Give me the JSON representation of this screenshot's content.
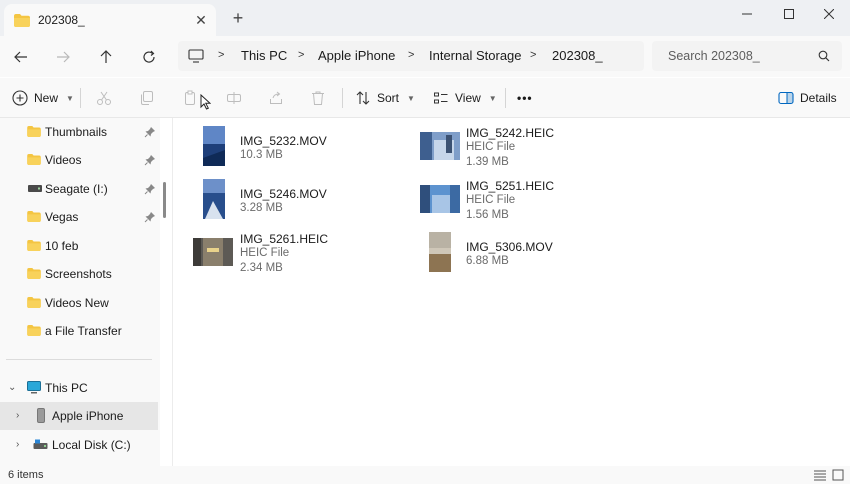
{
  "window": {
    "tab_title": "202308_",
    "new_tab": "+",
    "minimize_icon": "minimize-icon",
    "maximize_icon": "maximize-icon",
    "close_icon": "close-icon"
  },
  "address": {
    "crumbs": [
      "This PC",
      "Apple iPhone",
      "Internal Storage",
      "202308_"
    ],
    "search_placeholder": "Search 202308_"
  },
  "commands": {
    "new_label": "New",
    "sort_label": "Sort",
    "view_label": "View",
    "more_label": "•••",
    "details_label": "Details"
  },
  "sidebar": {
    "quick_access": [
      {
        "label": "Thumbnails",
        "icon": "folder-icon",
        "pinned": true
      },
      {
        "label": "Videos",
        "icon": "folder-icon",
        "pinned": true
      },
      {
        "label": "Seagate (I:)",
        "icon": "drive-icon",
        "pinned": true
      },
      {
        "label": "Vegas",
        "icon": "folder-icon",
        "pinned": true
      },
      {
        "label": "10 feb",
        "icon": "folder-icon",
        "pinned": false
      },
      {
        "label": "Screenshots",
        "icon": "folder-icon",
        "pinned": false
      },
      {
        "label": "Videos New",
        "icon": "folder-icon",
        "pinned": false
      },
      {
        "label": "a File Transfer",
        "icon": "folder-icon",
        "pinned": false
      }
    ],
    "tree": [
      {
        "label": "This PC",
        "icon": "pc-icon",
        "expanded": true
      },
      {
        "label": "Apple iPhone",
        "icon": "phone-icon",
        "selected": true
      },
      {
        "label": "Local Disk (C:)",
        "icon": "disk-icon"
      }
    ]
  },
  "files": [
    {
      "name": "IMG_5232.MOV",
      "type": "",
      "size": "10.3 MB",
      "thumb_color": "#3c63a8"
    },
    {
      "name": "IMG_5242.HEIC",
      "type": "HEIC File",
      "size": "1.39 MB",
      "thumb_color": "#5a7fb5"
    },
    {
      "name": "IMG_5246.MOV",
      "type": "",
      "size": "3.28 MB",
      "thumb_color": "#2f5a94"
    },
    {
      "name": "IMG_5251.HEIC",
      "type": "HEIC File",
      "size": "1.56 MB",
      "thumb_color": "#4f86c4"
    },
    {
      "name": "IMG_5261.HEIC",
      "type": "HEIC File",
      "size": "2.34 MB",
      "thumb_color": "#7d7466"
    },
    {
      "name": "IMG_5306.MOV",
      "type": "",
      "size": "6.88 MB",
      "thumb_color": "#9a8a74"
    }
  ],
  "status": {
    "count": "6 items"
  },
  "colors": {
    "folder": "#f4c542",
    "accent": "#0067c0",
    "selection": "#e6e6e6"
  }
}
